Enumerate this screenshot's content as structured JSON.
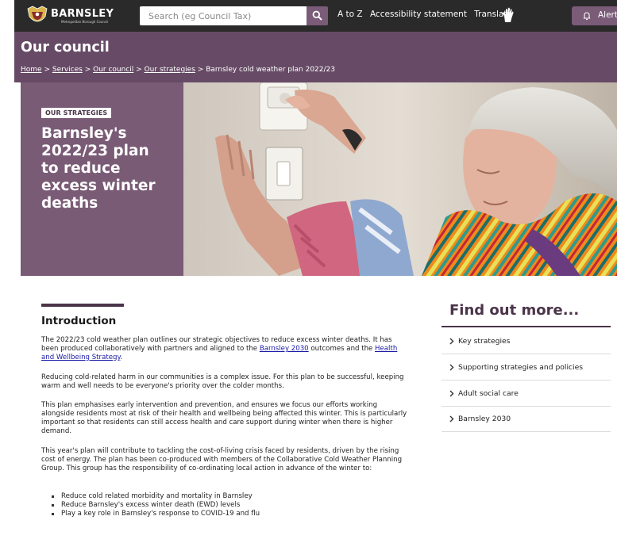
{
  "brand": {
    "name": "BARNSLEY",
    "subtitle": "Metropolitan Borough Council"
  },
  "search": {
    "placeholder": "Search (eg Council Tax)",
    "button_icon": "search-icon"
  },
  "top_nav": {
    "a_to_z": "A to Z",
    "accessibility": "Accessibility statement",
    "translate": "Translate",
    "alerts": "Alerts"
  },
  "header": {
    "title": "Our council"
  },
  "breadcrumb": {
    "items": [
      "Home",
      "Services",
      "Our council",
      "Our strategies"
    ],
    "separator": ">",
    "current": "Barnsley cold weather plan 2022/23"
  },
  "hero": {
    "tag": "OUR STRATEGIES",
    "title": "Barnsley's 2022/23 plan to reduce excess winter deaths"
  },
  "intro": {
    "heading": "Introduction",
    "p1_before": "The 2022/23 cold weather plan outlines our strategic objectives to reduce excess winter deaths. It has been produced collaboratively with partners and aligned to the ",
    "p1_link1": "Barnsley 2030",
    "p1_middle": " outcomes and the ",
    "p1_link2": "Health and Wellbeing Strategy",
    "p1_after": ".",
    "p2": "Reducing cold-related harm in our communities is a complex issue. For this plan to be successful, keeping warm and well needs to be everyone's priority over the colder months.",
    "p3": "This plan emphasises early intervention and prevention, and ensures we focus our efforts working alongside residents most at risk of their health and wellbeing being affected this winter. This is particularly important so that residents can still access health and care support during winter when there is higher demand.",
    "p4": "This year's plan will contribute to tackling the cost-of-living crisis faced by residents, driven by the rising cost of energy. The plan has been co-produced with members of the Collaborative Cold Weather Planning Group. This group has the responsibility of co-ordinating local action in advance of the winter to:",
    "bullets": [
      "Reduce cold related morbidity and mortality in Barnsley",
      "Reduce Barnsley's excess winter death (EWD) levels",
      "Play a key role in Barnsley's response to COVID-19 and flu"
    ]
  },
  "find_out_more": {
    "title": "Find out more...",
    "items": [
      "Key strategies",
      "Supporting strategies and policies",
      "Adult social care",
      "Barnsley 2030"
    ]
  },
  "colors": {
    "dark_bar": "#2a2a2a",
    "brand_purple": "#674b66",
    "hero_purple": "#7a5b76",
    "accent_dark": "#4a3449"
  }
}
